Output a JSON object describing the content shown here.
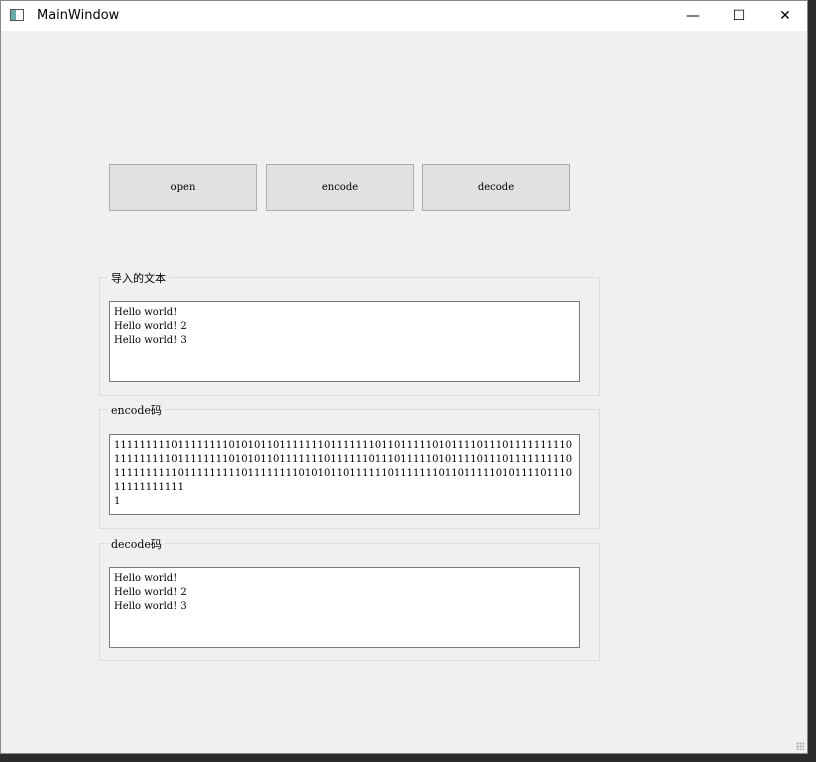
{
  "window": {
    "title": "MainWindow",
    "minimize": "—",
    "maximize": "☐",
    "close": "✕"
  },
  "buttons": {
    "open": "open",
    "encode": "encode",
    "decode": "decode"
  },
  "groups": {
    "imported": {
      "label": "导入的文本",
      "text": "Hello world!\nHello world! 2\nHello world! 3"
    },
    "encoded": {
      "label": "encode码",
      "text": "11111111101111111101010110111111101111111011011111010111101110111111111011111111101111111101010110111111101111110111011111010111101110111111111011111111110111111111011111111010101101111110111111101101111101011110111011111111111\n1"
    },
    "decoded": {
      "label": "decode码",
      "text": "Hello world!\nHello world! 2\nHello world! 3"
    }
  }
}
